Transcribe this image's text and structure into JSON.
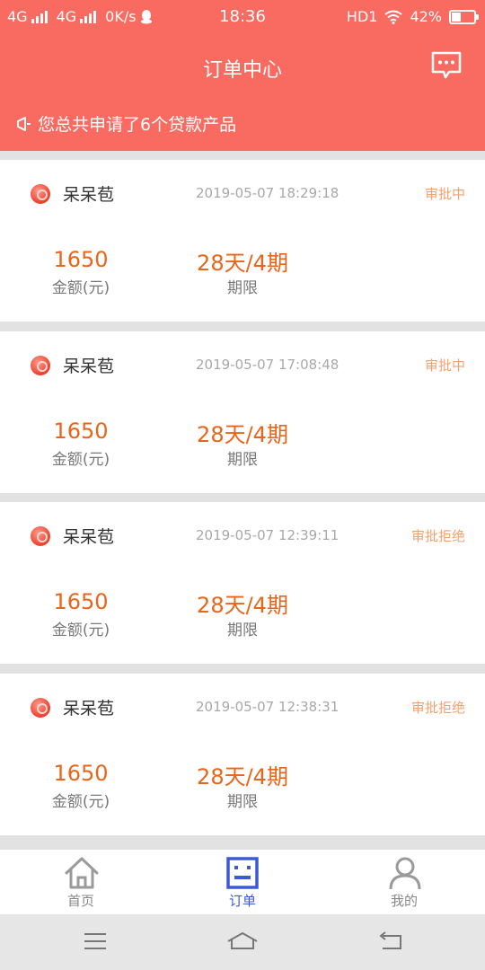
{
  "status_bar": {
    "network1": "4G",
    "network2": "4G",
    "speed": "0K/s",
    "time": "18:36",
    "hd": "HD1",
    "battery_text": "42%",
    "battery_level": 0.42
  },
  "header": {
    "title": "订单中心",
    "notice": "您总共申请了6个贷款产品"
  },
  "orders": [
    {
      "name": "呆呆苞",
      "time": "2019-05-07 18:29:18",
      "status": "审批中",
      "amount": "1650",
      "amount_label": "金额(元)",
      "term": "28天/4期",
      "term_label": "期限"
    },
    {
      "name": "呆呆苞",
      "time": "2019-05-07 17:08:48",
      "status": "审批中",
      "amount": "1650",
      "amount_label": "金额(元)",
      "term": "28天/4期",
      "term_label": "期限"
    },
    {
      "name": "呆呆苞",
      "time": "2019-05-07 12:39:11",
      "status": "审批拒绝",
      "amount": "1650",
      "amount_label": "金额(元)",
      "term": "28天/4期",
      "term_label": "期限"
    },
    {
      "name": "呆呆苞",
      "time": "2019-05-07 12:38:31",
      "status": "审批拒绝",
      "amount": "1650",
      "amount_label": "金额(元)",
      "term": "28天/4期",
      "term_label": "期限"
    }
  ],
  "tabs": [
    {
      "label": "首页",
      "icon": "home-icon",
      "active": false
    },
    {
      "label": "订单",
      "icon": "order-icon",
      "active": true
    },
    {
      "label": "我的",
      "icon": "user-icon",
      "active": false
    }
  ],
  "colors": {
    "header": "#f96b61",
    "accent_orange": "#e8651a",
    "status_orange": "#f8a06c",
    "tab_active": "#3b5bd6"
  }
}
